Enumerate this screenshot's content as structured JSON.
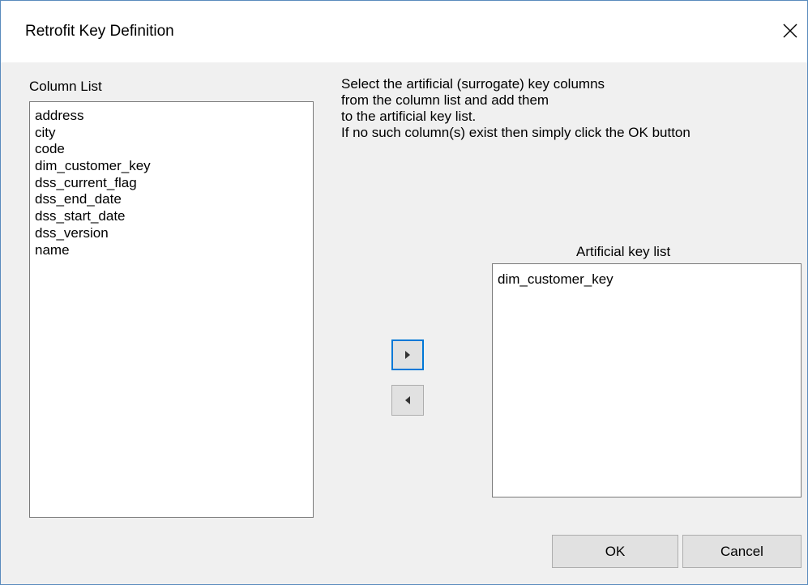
{
  "window": {
    "title": "Retrofit Key Definition",
    "close_icon": "close-icon"
  },
  "column_list": {
    "label": "Column List",
    "items": [
      "address",
      "city",
      "code",
      "dim_customer_key",
      "dss_current_flag",
      "dss_end_date",
      "dss_start_date",
      "dss_version",
      "name"
    ]
  },
  "instructions": {
    "lines": [
      "Select the artificial (surrogate) key columns",
      "from the column list and add them",
      "to the artificial key list.",
      "If no such column(s) exist then simply click the OK button"
    ]
  },
  "artificial_key_list": {
    "label": "Artificial key list",
    "items": [
      "dim_customer_key"
    ]
  },
  "move_buttons": {
    "add_icon": "triangle-right-icon",
    "remove_icon": "triangle-left-icon"
  },
  "buttons": {
    "ok_label": "OK",
    "cancel_label": "Cancel"
  },
  "colors": {
    "dialog_background": "#f0f0f0",
    "titlebar_background": "#ffffff",
    "window_border": "#5a8bbd",
    "focus_border": "#0078d7",
    "button_face": "#e1e1e1"
  }
}
